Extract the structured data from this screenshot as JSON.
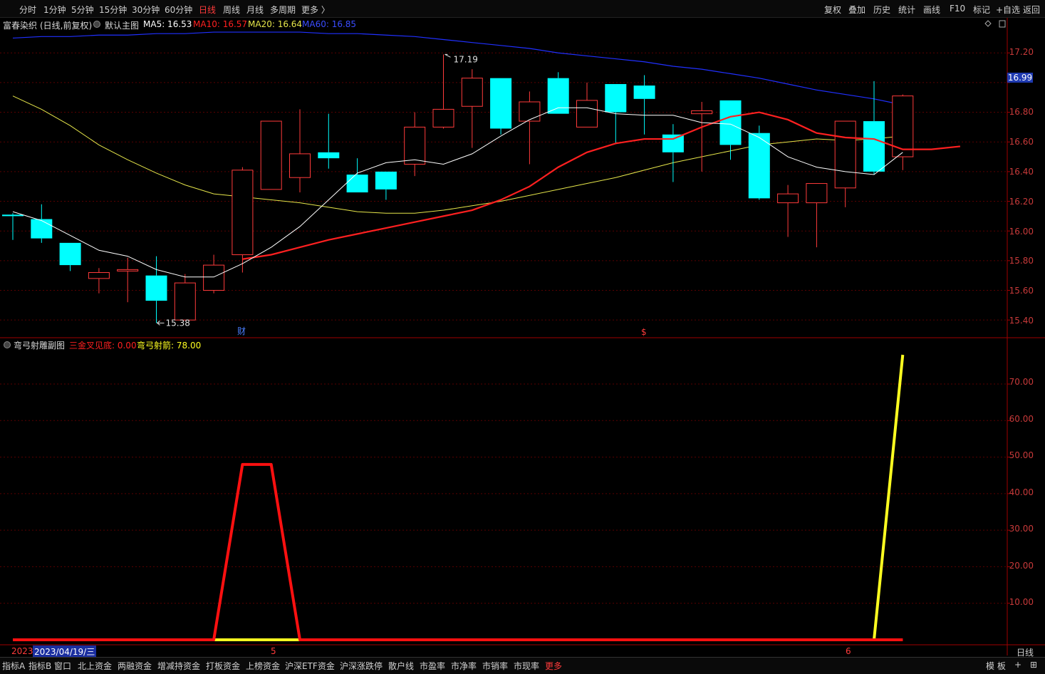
{
  "toolbar": {
    "timeframes": [
      "分时",
      "1分钟",
      "5分钟",
      "15分钟",
      "30分钟",
      "60分钟",
      "日线",
      "周线",
      "月线",
      "多周期",
      "更多 〉"
    ],
    "active_timeframe": "日线",
    "tools": [
      "复权",
      "叠加",
      "历史",
      "统计",
      "画线",
      "F10",
      "标记",
      "+自选",
      "返回"
    ]
  },
  "main_panel": {
    "stock_name": "富春染织",
    "mode": "(日线,前复权)",
    "indicator_name": "默认主图",
    "ma5_label": "MA5: 16.53",
    "ma10_label": "MA10: 16.57",
    "ma20_label": "MA20: 16.64",
    "ma60_label": "MA60: 16.85",
    "current_price": "16.99",
    "high_marker": "17.19",
    "low_marker": "15.38",
    "event_mark_1": "财",
    "event_mark_2": "$",
    "price_axis": [
      "17.20",
      "17.00",
      "16.80",
      "16.60",
      "16.40",
      "16.20",
      "16.00",
      "15.80",
      "15.60",
      "15.40"
    ]
  },
  "sub_panel": {
    "indicator_name": "弯弓射雕副图",
    "line1_label": "三金叉见底: 0.00",
    "line2_label": "弯弓射箭: 78.00",
    "value_axis": [
      "70.00",
      "60.00",
      "50.00",
      "40.00",
      "30.00",
      "20.00",
      "10.00"
    ]
  },
  "date_axis": {
    "year_label": "2023",
    "selected_date": "2023/04/19/三",
    "month_5": "5",
    "month_6": "6",
    "period_label": "日线"
  },
  "bottom_tabs": [
    "指标A",
    "指标B",
    "窗口",
    "北上资金",
    "两融资金",
    "增减持资金",
    "打板资金",
    "上榜资金",
    "沪深ETF资金",
    "沪深涨跌停",
    "散户线",
    "市盈率",
    "市净率",
    "市销率",
    "市现率",
    "更多"
  ],
  "bottom_right": [
    "模 板",
    "+",
    "⊞"
  ],
  "colors": {
    "up": "#ff3b3b",
    "down": "#00ffff",
    "ma5": "#ffffff",
    "ma10": "#ff2020",
    "ma20": "#e6e64a",
    "ma60": "#2030ff",
    "sub_line1": "#ff1010",
    "sub_line2": "#ffff20",
    "grid": "#5a0000"
  },
  "chart_data": [
    {
      "type": "candlestick",
      "title": "富春染织 (日线,前复权)",
      "ylim": [
        15.3,
        17.35
      ],
      "candles": [
        {
          "o": 16.11,
          "c": 16.1,
          "h": 16.12,
          "l": 15.94
        },
        {
          "o": 16.08,
          "c": 15.95,
          "h": 16.18,
          "l": 15.92
        },
        {
          "o": 15.92,
          "c": 15.77,
          "h": 15.92,
          "l": 15.73
        },
        {
          "o": 15.68,
          "c": 15.72,
          "h": 15.75,
          "l": 15.58
        },
        {
          "o": 15.73,
          "c": 15.74,
          "h": 15.82,
          "l": 15.52
        },
        {
          "o": 15.7,
          "c": 15.53,
          "h": 15.83,
          "l": 15.38
        },
        {
          "o": 15.4,
          "c": 15.65,
          "h": 15.71,
          "l": 15.4
        },
        {
          "o": 15.6,
          "c": 15.77,
          "h": 15.84,
          "l": 15.58
        },
        {
          "o": 15.84,
          "c": 16.41,
          "h": 16.43,
          "l": 15.72
        },
        {
          "o": 16.28,
          "c": 16.74,
          "h": 16.74,
          "l": 16.28
        },
        {
          "o": 16.36,
          "c": 16.52,
          "h": 16.82,
          "l": 16.26
        },
        {
          "o": 16.53,
          "c": 16.49,
          "h": 16.79,
          "l": 16.42
        },
        {
          "o": 16.38,
          "c": 16.26,
          "h": 16.49,
          "l": 16.26
        },
        {
          "o": 16.4,
          "c": 16.28,
          "h": 16.4,
          "l": 16.21
        },
        {
          "o": 16.45,
          "c": 16.7,
          "h": 16.8,
          "l": 16.37
        },
        {
          "o": 16.7,
          "c": 16.82,
          "h": 17.19,
          "l": 16.69
        },
        {
          "o": 16.84,
          "c": 17.03,
          "h": 17.09,
          "l": 16.56
        },
        {
          "o": 17.03,
          "c": 16.69,
          "h": 17.03,
          "l": 16.65
        },
        {
          "o": 16.74,
          "c": 16.87,
          "h": 16.94,
          "l": 16.45
        },
        {
          "o": 17.03,
          "c": 16.79,
          "h": 17.07,
          "l": 16.79
        },
        {
          "o": 16.7,
          "c": 16.88,
          "h": 17.0,
          "l": 16.7
        },
        {
          "o": 16.99,
          "c": 16.8,
          "h": 16.99,
          "l": 16.59
        },
        {
          "o": 16.98,
          "c": 16.89,
          "h": 17.05,
          "l": 16.65
        },
        {
          "o": 16.65,
          "c": 16.53,
          "h": 16.72,
          "l": 16.33
        },
        {
          "o": 16.79,
          "c": 16.81,
          "h": 16.87,
          "l": 16.4
        },
        {
          "o": 16.88,
          "c": 16.58,
          "h": 16.88,
          "l": 16.48
        },
        {
          "o": 16.66,
          "c": 16.22,
          "h": 16.71,
          "l": 16.21
        },
        {
          "o": 16.19,
          "c": 16.25,
          "h": 16.31,
          "l": 15.96
        },
        {
          "o": 16.19,
          "c": 16.32,
          "h": 16.32,
          "l": 15.89
        },
        {
          "o": 16.29,
          "c": 16.74,
          "h": 16.74,
          "l": 16.16
        },
        {
          "o": 16.74,
          "c": 16.4,
          "h": 17.01,
          "l": 16.38
        },
        {
          "o": 16.5,
          "c": 16.91,
          "h": 16.92,
          "l": 16.41
        }
      ],
      "ma5": [
        16.13,
        16.07,
        15.97,
        15.87,
        15.83,
        15.74,
        15.69,
        15.69,
        15.78,
        15.89,
        16.03,
        16.21,
        16.39,
        16.46,
        16.48,
        16.45,
        16.52,
        16.64,
        16.75,
        16.83,
        16.83,
        16.79,
        16.78,
        16.78,
        16.73,
        16.72,
        16.63,
        16.5,
        16.43,
        16.4,
        16.38,
        16.53
      ],
      "ma10": [
        null,
        null,
        null,
        null,
        null,
        null,
        null,
        null,
        15.81,
        15.84,
        15.89,
        15.94,
        15.98,
        16.02,
        16.06,
        16.1,
        16.14,
        16.21,
        16.3,
        16.43,
        16.53,
        16.59,
        16.62,
        16.62,
        16.7,
        16.77,
        16.8,
        16.75,
        16.66,
        16.63,
        16.62,
        16.55,
        16.55,
        16.57
      ],
      "ma20": [
        16.91,
        16.82,
        16.71,
        16.58,
        16.48,
        16.39,
        16.31,
        16.25,
        16.23,
        16.21,
        16.19,
        16.16,
        16.13,
        16.12,
        16.12,
        16.14,
        16.17,
        16.2,
        16.24,
        16.28,
        16.32,
        16.36,
        16.41,
        16.46,
        16.5,
        16.54,
        16.58,
        16.6,
        16.62,
        16.61,
        16.62,
        16.64
      ],
      "ma60": [
        17.3,
        17.31,
        17.31,
        17.32,
        17.32,
        17.33,
        17.33,
        17.34,
        17.34,
        17.34,
        17.34,
        17.33,
        17.33,
        17.32,
        17.31,
        17.29,
        17.27,
        17.25,
        17.23,
        17.2,
        17.18,
        17.16,
        17.14,
        17.11,
        17.09,
        17.06,
        17.03,
        16.99,
        16.95,
        16.92,
        16.89,
        16.85
      ]
    },
    {
      "type": "line",
      "title": "弯弓射雕副图",
      "ylim": [
        0,
        80
      ],
      "series": [
        {
          "name": "三金叉见底",
          "values": [
            0,
            0,
            0,
            0,
            0,
            0,
            0,
            0,
            48,
            48,
            0,
            0,
            0,
            0,
            0,
            0,
            0,
            0,
            0,
            0,
            0,
            0,
            0,
            0,
            0,
            0,
            0,
            0,
            0,
            0,
            0,
            0
          ]
        },
        {
          "name": "弯弓射箭",
          "values": [
            0,
            0,
            0,
            0,
            0,
            0,
            0,
            0,
            0,
            0,
            0,
            0,
            0,
            0,
            0,
            0,
            0,
            0,
            0,
            0,
            0,
            0,
            0,
            0,
            0,
            0,
            0,
            0,
            0,
            0,
            0,
            78
          ]
        }
      ]
    }
  ]
}
